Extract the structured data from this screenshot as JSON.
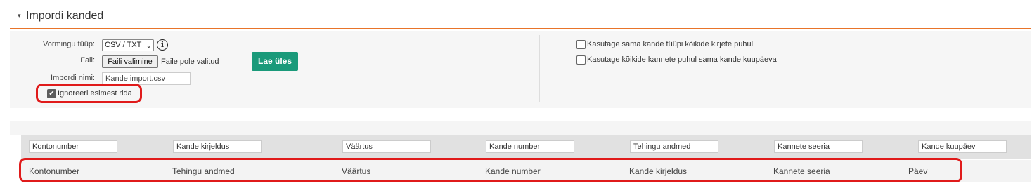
{
  "header": {
    "caret": "▾",
    "title": "Impordi kanded"
  },
  "form": {
    "format_label": "Vormingu tüüp:",
    "format_value": "CSV / TXT",
    "file_label": "Fail:",
    "file_button": "Faili valimine",
    "file_status": "Faile pole valitud",
    "upload_button": "Lae üles",
    "import_name_label": "Impordi nimi:",
    "import_name_value": "Kande import.csv",
    "ignore_first_row_label": "Ignoreeri esimest rida",
    "ignore_first_row_checked": true
  },
  "options": [
    {
      "label": "Kasutage sama kande tüüpi kõikide kirjete puhul",
      "checked": false
    },
    {
      "label": "Kasutage kõikide kannete puhul sama kande kuupäeva",
      "checked": false
    }
  ],
  "mapping": {
    "inputs": [
      "Kontonumber",
      "Kande kirjeldus",
      "Väärtus",
      "Kande number",
      "Tehingu andmed",
      "Kannete seeria",
      "Kande kuupäev"
    ],
    "labels": [
      "Kontonumber",
      "Tehingu andmed",
      "Väärtus",
      "Kande number",
      "Kande kirjeldus",
      "Kannete seeria",
      "Päev"
    ]
  },
  "colors": {
    "accent": "#e8742a",
    "upload": "#1a9a7a",
    "highlight": "#e01b1b"
  }
}
